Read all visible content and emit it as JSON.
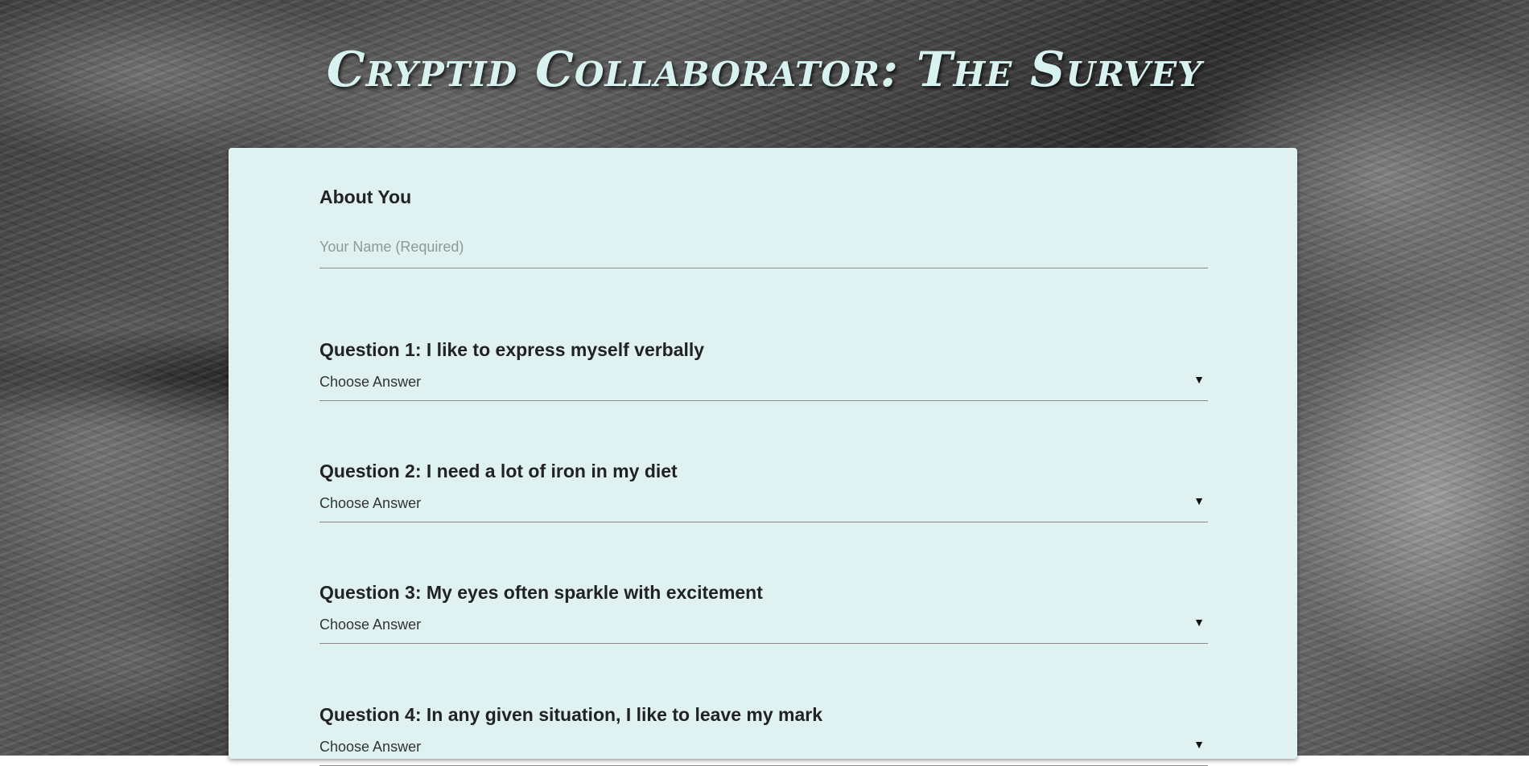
{
  "page": {
    "title": "Cryptid Collaborator: The Survey"
  },
  "about": {
    "heading": "About You",
    "name_placeholder": "Your Name (Required)",
    "name_value": ""
  },
  "questions": [
    {
      "label": "Question 1: I like to express myself verbally",
      "selected": "Choose Answer"
    },
    {
      "label": "Question 2: I need a lot of iron in my diet",
      "selected": "Choose Answer"
    },
    {
      "label": "Question 3: My eyes often sparkle with excitement",
      "selected": "Choose Answer"
    },
    {
      "label": "Question 4: In any given situation, I like to leave my mark",
      "selected": "Choose Answer"
    }
  ],
  "icons": {
    "dropdown": "triangle-down-icon"
  },
  "colors": {
    "card_background": "#dff1f1",
    "title_color": "#d8f2f0",
    "underline": "#8a8a8a"
  }
}
